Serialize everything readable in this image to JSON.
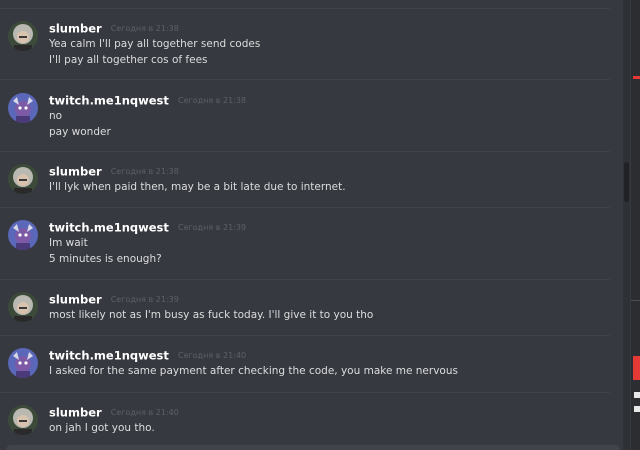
{
  "colors": {
    "background": "#36393f",
    "username": "#ffffff",
    "timestamp": "#5d6067",
    "message_text": "#dcddde",
    "divider": "#40434a",
    "edge_accent_red": "#e53935"
  },
  "messages": [
    {
      "author": "slumber",
      "avatar": "grey-hair-avatar-icon",
      "timestamp": "Сегодня в 21:38",
      "lines": [
        "Yea calm I'll pay all together send codes",
        "I'll pay all together cos of fees"
      ]
    },
    {
      "author": "twitch.me1nqwest",
      "avatar": "purple-character-avatar-icon",
      "timestamp": "Сегодня в 21:38",
      "lines": [
        "no",
        "pay wonder"
      ]
    },
    {
      "author": "slumber",
      "avatar": "grey-hair-avatar-icon",
      "timestamp": "Сегодня в 21:38",
      "lines": [
        "I'll lyk when paid then, may be a bit late due to internet."
      ]
    },
    {
      "author": "twitch.me1nqwest",
      "avatar": "purple-character-avatar-icon",
      "timestamp": "Сегодня в 21:39",
      "lines": [
        "Im wait",
        "5 minutes is enough?"
      ]
    },
    {
      "author": "slumber",
      "avatar": "grey-hair-avatar-icon",
      "timestamp": "Сегодня в 21:39",
      "lines": [
        "most likely not as I'm busy as fuck today. I'll give it to you tho"
      ]
    },
    {
      "author": "twitch.me1nqwest",
      "avatar": "purple-character-avatar-icon",
      "timestamp": "Сегодня в 21:40",
      "lines": [
        "I asked for the same payment after checking the code, you make me nervous"
      ]
    },
    {
      "author": "slumber",
      "avatar": "grey-hair-avatar-icon",
      "timestamp": "Сегодня в 21:40",
      "lines": [
        "on jah I got you tho."
      ]
    }
  ]
}
